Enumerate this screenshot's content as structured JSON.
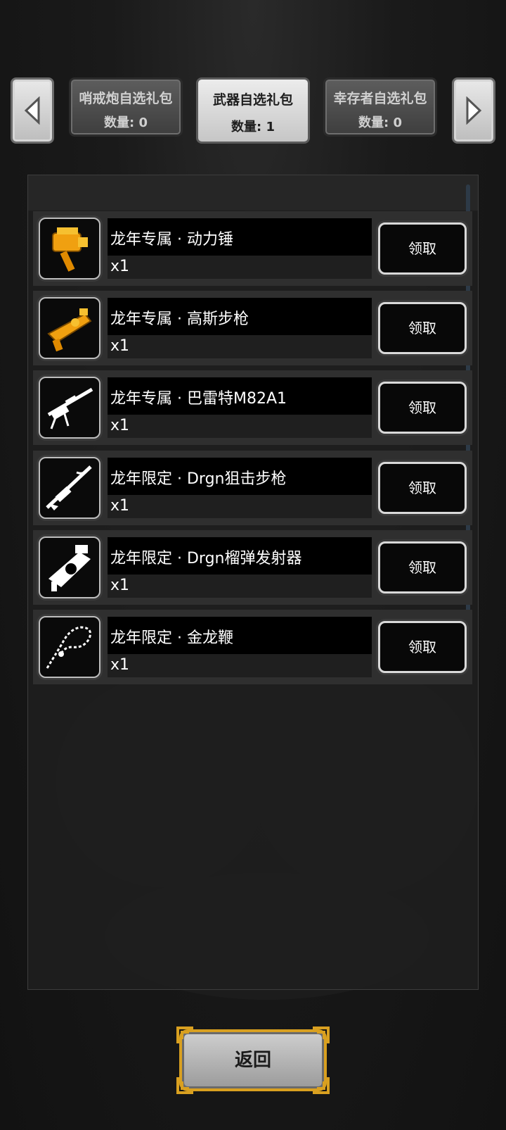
{
  "tabs": [
    {
      "title": "哨戒炮自选礼包",
      "count": "数量: 0",
      "active": false
    },
    {
      "title": "武器自选礼包",
      "count": "数量: 1",
      "active": true
    },
    {
      "title": "幸存者自选礼包",
      "count": "数量: 0",
      "active": false
    }
  ],
  "items": [
    {
      "name": "龙年专属 · 动力锤",
      "qty": "x1",
      "claim": "领取",
      "icon": "power-hammer-icon"
    },
    {
      "name": "龙年专属 · 高斯步枪",
      "qty": "x1",
      "claim": "领取",
      "icon": "gauss-rifle-icon"
    },
    {
      "name": "龙年专属 · 巴雷特M82A1",
      "qty": "x1",
      "claim": "领取",
      "icon": "barrett-rifle-icon"
    },
    {
      "name": "龙年限定 · Drgn狙击步枪",
      "qty": "x1",
      "claim": "领取",
      "icon": "dragon-sniper-icon"
    },
    {
      "name": "龙年限定 · Drgn榴弹发射器",
      "qty": "x1",
      "claim": "领取",
      "icon": "dragon-grenade-launcher-icon"
    },
    {
      "name": "龙年限定 · 金龙鞭",
      "qty": "x1",
      "claim": "领取",
      "icon": "golden-dragon-whip-icon"
    }
  ],
  "back_label": "返回",
  "colors": {
    "gold": "#d9a020",
    "orange_icon": "#f0a010"
  }
}
